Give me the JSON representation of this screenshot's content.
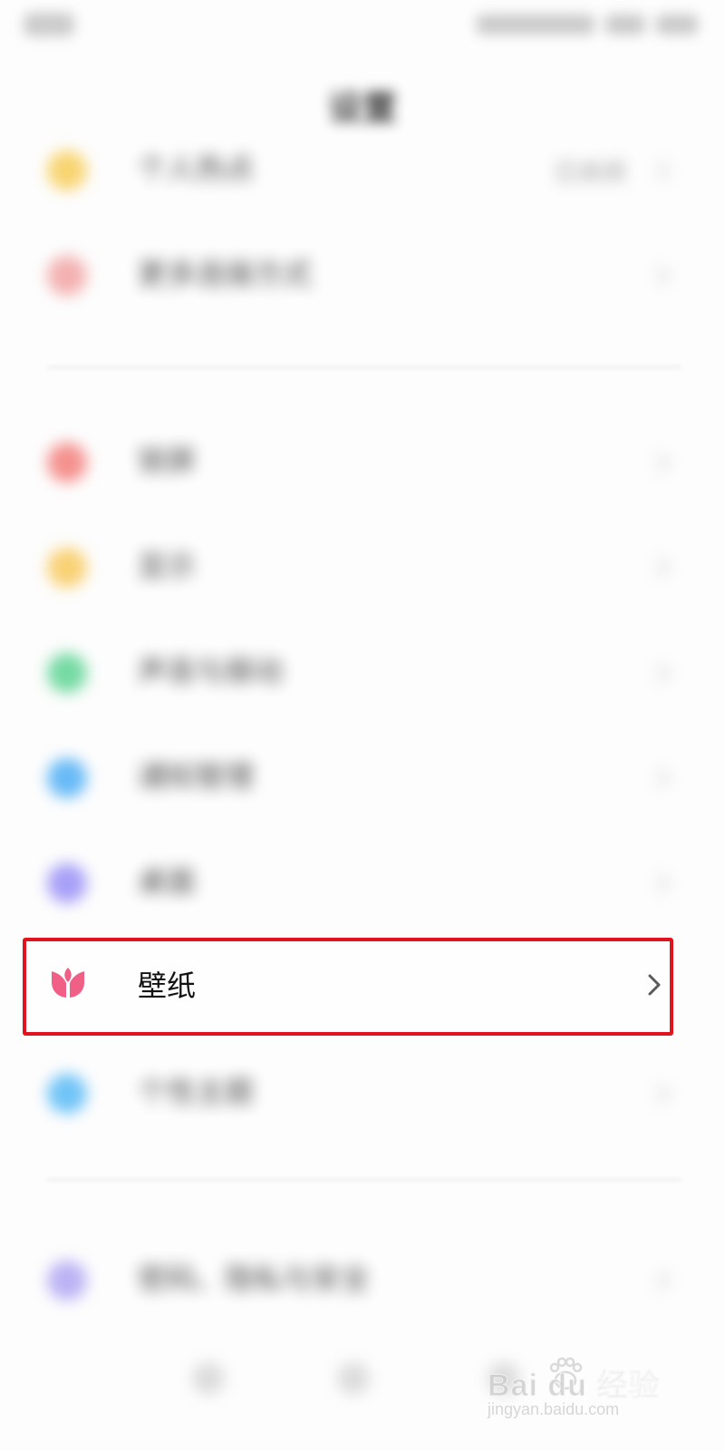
{
  "status_bar": {
    "time": "",
    "icons": [
      "signal-icon",
      "wifi-icon",
      "battery-icon"
    ]
  },
  "header": {
    "title": "设置"
  },
  "settings": {
    "group1": [
      {
        "label": "个人热点",
        "value": "已关闭",
        "icon": "hotspot-icon",
        "color": "#f7c94a"
      },
      {
        "label": "更多连接方式",
        "value": "",
        "icon": "link-icon",
        "color": "#f19b9b"
      }
    ],
    "group2": [
      {
        "label": "锁屏",
        "value": "",
        "icon": "lock-icon",
        "color": "#f2736f"
      },
      {
        "label": "显示",
        "value": "",
        "icon": "display-icon",
        "color": "#f8c54f"
      },
      {
        "label": "声音与振动",
        "value": "",
        "icon": "sound-icon",
        "color": "#4fd08a"
      },
      {
        "label": "通知管理",
        "value": "",
        "icon": "notification-icon",
        "color": "#3ea7f5"
      },
      {
        "label": "桌面",
        "value": "",
        "icon": "home-icon",
        "color": "#8f86f6"
      },
      {
        "label": "壁纸",
        "value": "",
        "icon": "tulip-icon",
        "color": "#ef5f86"
      },
      {
        "label": "个性主题",
        "value": "",
        "icon": "theme-icon",
        "color": "#49b4f6"
      }
    ],
    "group3": [
      {
        "label": "密码、隐私与安全",
        "value": "",
        "icon": "shield-icon",
        "color": "#a99ef2"
      }
    ]
  },
  "highlight": {
    "color": "#e0141e"
  },
  "watermark": {
    "brand": "Bai du 经验",
    "url": "jingyan.baidu.com"
  }
}
